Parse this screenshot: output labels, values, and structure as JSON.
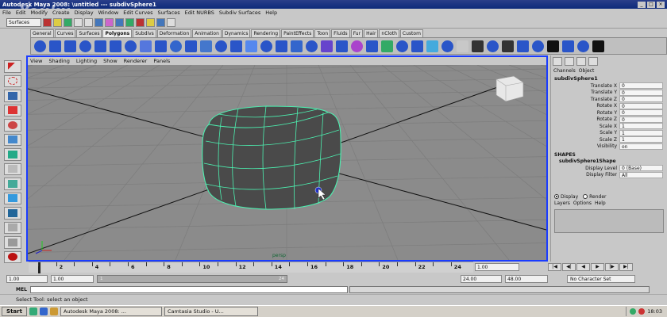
{
  "window": {
    "title": "Autodesk Maya 2008: \\untitled  ---  subdivSphere1",
    "controls": [
      "_",
      "□",
      "×"
    ]
  },
  "watermark": "Youku",
  "menubar": [
    "File",
    "Edit",
    "Modify",
    "Create",
    "Display",
    "Window",
    "Edit Curves",
    "Surfaces",
    "Edit NURBS",
    "Subdiv Surfaces",
    "Help"
  ],
  "statusline": {
    "mode": "Surfaces"
  },
  "shelf": {
    "tabs": [
      "General",
      "Curves",
      "Surfaces",
      "Polygons",
      "Subdivs",
      "Deformation",
      "Animation",
      "Dynamics",
      "Rendering",
      "PaintEffects",
      "Toon",
      "Fluids",
      "Fur",
      "Hair",
      "nCloth",
      "Custom"
    ],
    "active_tab": "Polygons"
  },
  "viewport": {
    "panel_menu": [
      "View",
      "Shading",
      "Lighting",
      "Show",
      "Renderer",
      "Panels"
    ],
    "camera": "persp",
    "colors": {
      "wire": "#4cf0b0",
      "grid": "#7a7a7a",
      "bg": "#8d8d8d"
    }
  },
  "channelbox": {
    "menu": [
      "Channels",
      "Object"
    ],
    "object": "subdivSphere1",
    "attrs": [
      {
        "label": "Translate X",
        "value": "0"
      },
      {
        "label": "Translate Y",
        "value": "0"
      },
      {
        "label": "Translate Z",
        "value": "0"
      },
      {
        "label": "Rotate X",
        "value": "0"
      },
      {
        "label": "Rotate Y",
        "value": "0"
      },
      {
        "label": "Rotate Z",
        "value": "0"
      },
      {
        "label": "Scale X",
        "value": "1"
      },
      {
        "label": "Scale Y",
        "value": "1"
      },
      {
        "label": "Scale Z",
        "value": "1"
      },
      {
        "label": "Visibility",
        "value": "on"
      }
    ],
    "shapes_title": "SHAPES",
    "shape_name": "subdivSphere1Shape",
    "shape_attrs": [
      {
        "label": "Display Level",
        "value": "0 (Base)"
      },
      {
        "label": "Display Filter",
        "value": "All"
      }
    ],
    "layer_display": "Display",
    "layer_render": "Render",
    "layer_menu": [
      "Layers",
      "Options",
      "Help"
    ]
  },
  "timeline": {
    "ticks": [
      "2",
      "4",
      "6",
      "8",
      "10",
      "12",
      "14",
      "16",
      "18",
      "20",
      "22",
      "24"
    ],
    "current_frame": "1.00"
  },
  "range": {
    "start": "1.00",
    "start2": "1.00",
    "bar_start": "1",
    "bar_end": "24",
    "end": "24.00",
    "end2": "48.00",
    "character_set": "No Character Set"
  },
  "command": {
    "label": "MEL"
  },
  "help_line": "Select Tool: select an object",
  "taskbar": {
    "start": "Start",
    "buttons": [
      "Autodesk Maya 2008: ...",
      "Camtasia Studio - U..."
    ],
    "clock": "18:03"
  }
}
